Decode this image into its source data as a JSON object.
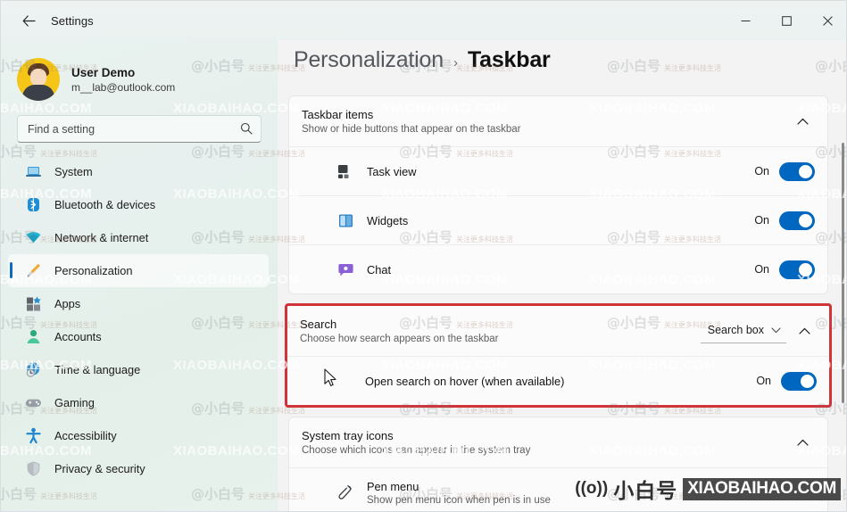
{
  "window": {
    "title": "Settings",
    "back_icon": "back-arrow-icon",
    "minimize": "—",
    "maximize": "□",
    "close": "✕"
  },
  "sidebar": {
    "profile": {
      "name": "User Demo",
      "email": "m__lab@outlook.com",
      "avatar_icon": "user-avatar-icon"
    },
    "search": {
      "placeholder": "Find a setting",
      "value": "",
      "icon": "search-icon"
    },
    "items": [
      {
        "label": "System",
        "icon": "laptop-icon",
        "active": false
      },
      {
        "label": "Bluetooth & devices",
        "icon": "bluetooth-icon",
        "active": false
      },
      {
        "label": "Network & internet",
        "icon": "wifi-icon",
        "active": false
      },
      {
        "label": "Personalization",
        "icon": "paintbrush-icon",
        "active": true
      },
      {
        "label": "Apps",
        "icon": "apps-grid-icon",
        "active": false
      },
      {
        "label": "Accounts",
        "icon": "person-icon",
        "active": false
      },
      {
        "label": "Time & language",
        "icon": "globe-clock-icon",
        "active": false
      },
      {
        "label": "Gaming",
        "icon": "gamepad-icon",
        "active": false
      },
      {
        "label": "Accessibility",
        "icon": "accessibility-person-icon",
        "active": false
      },
      {
        "label": "Privacy & security",
        "icon": "shield-icon",
        "active": false
      }
    ]
  },
  "main": {
    "breadcrumb": {
      "parent": "Personalization",
      "separator": "›",
      "current": "Taskbar"
    },
    "taskbar_items": {
      "title": "Taskbar items",
      "subtitle": "Show or hide buttons that appear on the taskbar",
      "collapse_icon": "chevron-up-icon",
      "rows": [
        {
          "label": "Task view",
          "icon": "task-view-icon",
          "state": "On"
        },
        {
          "label": "Widgets",
          "icon": "widgets-icon",
          "state": "On"
        },
        {
          "label": "Chat",
          "icon": "chat-icon",
          "state": "On"
        }
      ]
    },
    "search_section": {
      "title": "Search",
      "subtitle": "Choose how search appears on the taskbar",
      "dropdown_value": "Search box",
      "dropdown_icon": "chevron-down-icon",
      "collapse_icon": "chevron-up-icon",
      "row": {
        "label": "Open search on hover (when available)",
        "state": "On"
      },
      "highlight_color": "#d13438"
    },
    "system_tray": {
      "title": "System tray icons",
      "subtitle": "Choose which icons can appear in the system tray",
      "collapse_icon": "chevron-up-icon",
      "rows": [
        {
          "label": "Pen menu",
          "sub": "Show pen menu icon when pen is in use",
          "icon": "pen-icon"
        }
      ]
    },
    "cursor_icon": "mouse-pointer-icon",
    "accent_color": "#0067c0"
  },
  "watermark": {
    "latin": "XIAOBAIHAO.COM",
    "chinese": "@小白号",
    "chinese_small": "关注更多科技生活",
    "brand_wave": "((o))",
    "brand_cn": "小白号",
    "brand_box": "XIAOBAIHAO.COM"
  }
}
